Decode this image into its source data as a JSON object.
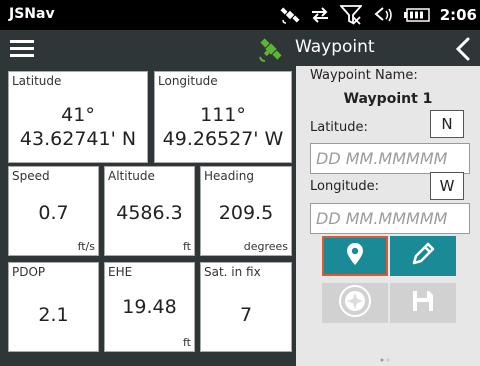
{
  "status_bar": {
    "app_title": "JSNav",
    "time": "2:06",
    "icons": [
      "satellite-icon",
      "sync-arrows-icon",
      "no-signal-icon",
      "speaker-icon",
      "battery-icon"
    ]
  },
  "toolbar": {
    "title": "Waypoint",
    "menu_icon": "hamburger-menu-icon",
    "gps_icon": "satellite-icon",
    "back_icon": "chevron-left-icon",
    "gps_color": "#5cb534"
  },
  "tiles": {
    "latitude": {
      "label": "Latitude",
      "value_deg": "41°",
      "value_min": "43.62741' N"
    },
    "longitude": {
      "label": "Longitude",
      "value_deg": "111°",
      "value_min": "49.26527' W"
    },
    "speed": {
      "label": "Speed",
      "value": "0.7",
      "unit": "ft/s"
    },
    "altitude": {
      "label": "Altitude",
      "value": "4586.3",
      "unit": "ft"
    },
    "heading": {
      "label": "Heading",
      "value": "209.5",
      "unit": "degrees"
    },
    "pdop": {
      "label": "PDOP",
      "value": "2.1"
    },
    "ehe": {
      "label": "EHE",
      "value": "19.48",
      "unit": "ft"
    },
    "sat_in_fix": {
      "label": "Sat. in fix",
      "value": "7"
    }
  },
  "waypoint_form": {
    "name_label": "Waypoint Name:",
    "name_value": "Waypoint 1",
    "latitude_label": "Latitude:",
    "latitude_hemisphere": "N",
    "latitude_placeholder": "DD MM.MMMMM",
    "longitude_label": "Longitude:",
    "longitude_hemisphere": "W",
    "longitude_placeholder": "DD MM.MMMMM",
    "buttons": {
      "pin_icon": "location-pin-icon",
      "edit_icon": "pencil-icon",
      "compass_icon": "compass-icon",
      "save_icon": "floppy-save-icon"
    },
    "accent_color": "#1a8a96",
    "selected_border_color": "#e0592a"
  }
}
